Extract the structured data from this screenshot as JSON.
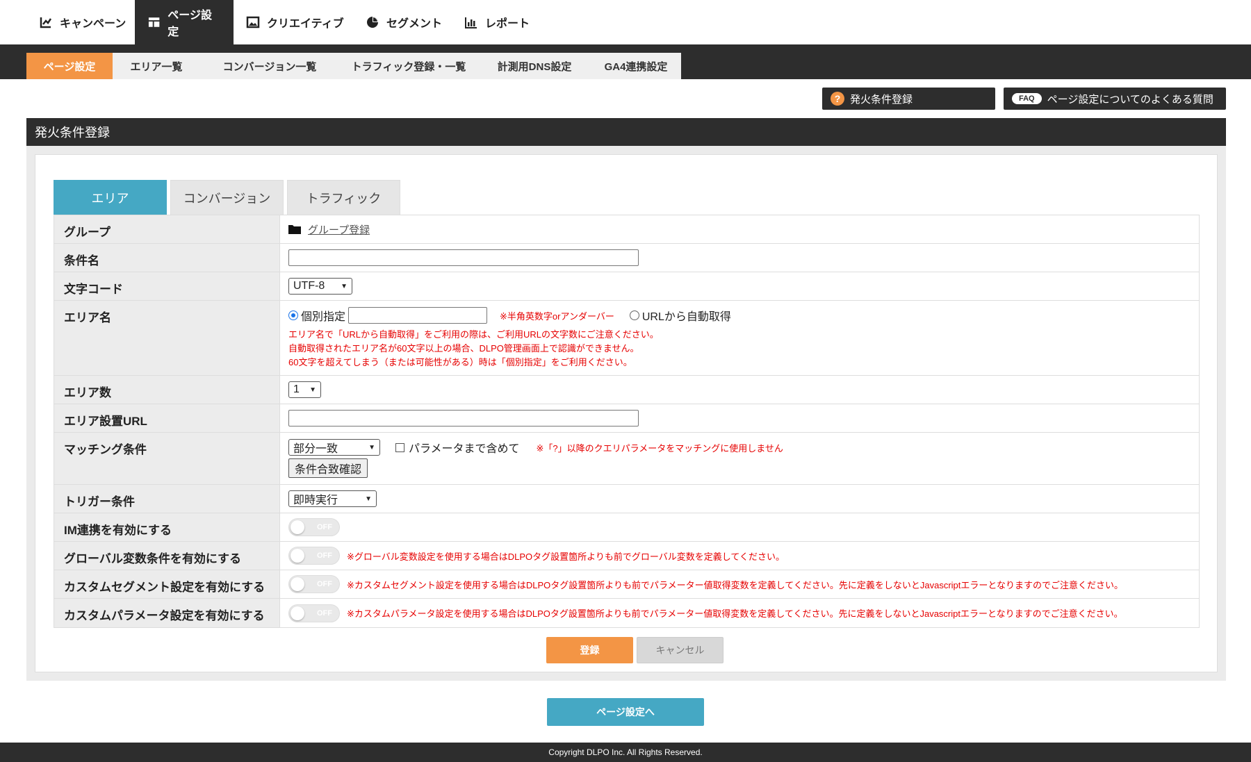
{
  "topnav": {
    "items": [
      {
        "label": "キャンペーン",
        "icon": "chart-edit-icon"
      },
      {
        "label": "ページ設定",
        "icon": "layout-icon",
        "active": true
      },
      {
        "label": "クリエイティブ",
        "icon": "image-icon"
      },
      {
        "label": "セグメント",
        "icon": "pie-chart-icon"
      },
      {
        "label": "レポート",
        "icon": "bar-chart-icon"
      }
    ]
  },
  "subnav": {
    "tabs": [
      {
        "label": "ページ設定",
        "active": true
      },
      {
        "label": "エリア一覧"
      },
      {
        "label": "コンバージョン一覧"
      },
      {
        "label": "トラフィック登録・一覧"
      },
      {
        "label": "計測用DNS設定"
      },
      {
        "label": "GA4連携設定"
      }
    ]
  },
  "top_buttons": {
    "fire_register": {
      "icon_text": "?",
      "label": "発火条件登録"
    },
    "faq": {
      "badge": "FAQ",
      "label": "ページ設定についてのよくある質問"
    }
  },
  "section": {
    "title": "発火条件登録",
    "tabs": [
      {
        "label": "エリア",
        "active": true
      },
      {
        "label": "コンバージョン"
      },
      {
        "label": "トラフィック"
      }
    ]
  },
  "form": {
    "group": {
      "label": "グループ",
      "link": "グループ登録"
    },
    "condition_name": {
      "label": "条件名",
      "value": ""
    },
    "charset": {
      "label": "文字コード",
      "value": "UTF-8"
    },
    "area_name": {
      "label": "エリア名",
      "option_manual": "個別指定",
      "manual_value": "",
      "hint": "※半角英数字orアンダーバー",
      "option_auto": "URLから自動取得",
      "notes": [
        "エリア名で「URLから自動取得」をご利用の際は、ご利用URLの文字数にご注意ください。",
        "自動取得されたエリア名が60文字以上の場合、DLPO管理画面上で認識ができません。",
        "60文字を超えてしまう（または可能性がある）時は「個別指定」をご利用ください。"
      ]
    },
    "area_count": {
      "label": "エリア数",
      "value": "1"
    },
    "area_url": {
      "label": "エリア設置URL",
      "value": ""
    },
    "matching": {
      "label": "マッチング条件",
      "value": "部分一致",
      "param_checkbox": "パラメータまで含めて",
      "note": "※「?」以降のクエリパラメータをマッチングに使用しません",
      "check_button": "条件合致確認"
    },
    "trigger": {
      "label": "トリガー条件",
      "value": "即時実行"
    },
    "im": {
      "label": "IM連携を有効にする",
      "toggle": "OFF"
    },
    "global_var": {
      "label": "グローバル変数条件を有効にする",
      "toggle": "OFF",
      "note": "※グローバル変数設定を使用する場合はDLPOタグ設置箇所よりも前でグローバル変数を定義してください。"
    },
    "custom_segment": {
      "label": "カスタムセグメント設定を有効にする",
      "toggle": "OFF",
      "note": "※カスタムセグメント設定を使用する場合はDLPOタグ設置箇所よりも前でパラメーター値取得変数を定義してください。先に定義をしないとJavascriptエラーとなりますのでご注意ください。"
    },
    "custom_param": {
      "label": "カスタムパラメータ設定を有効にする",
      "toggle": "OFF",
      "note": "※カスタムパラメータ設定を使用する場合はDLPOタグ設置箇所よりも前でパラメーター値取得変数を定義してください。先に定義をしないとJavascriptエラーとなりますのでご注意ください。"
    }
  },
  "actions": {
    "register": "登録",
    "cancel": "キャンセル",
    "back": "ページ設定へ"
  },
  "footer": {
    "copyright": "Copyright DLPO Inc. All Rights Reserved."
  },
  "colors": {
    "accent_orange": "#f39545",
    "accent_blue": "#45a8c4",
    "dark": "#2d2d2d",
    "error_red": "#e60000"
  }
}
